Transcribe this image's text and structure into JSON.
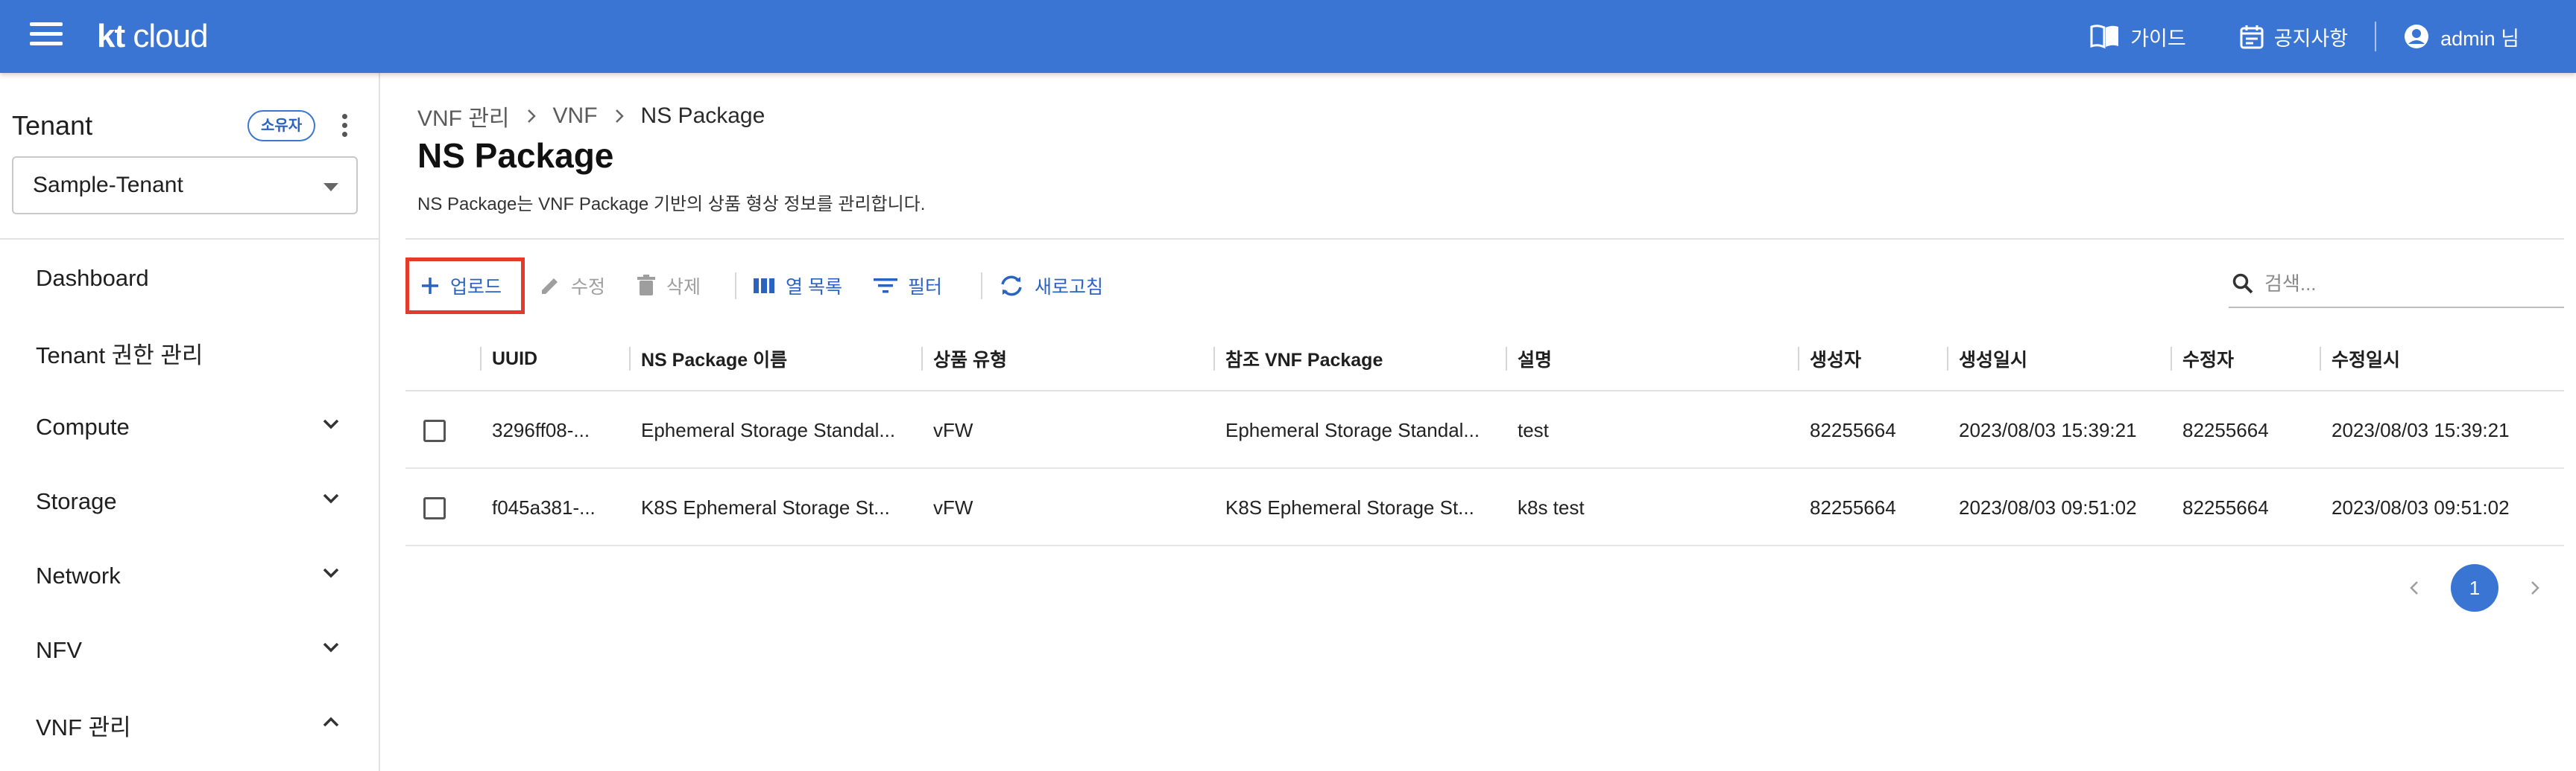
{
  "appbar": {
    "brand_kt": "kt",
    "brand_cloud": "cloud",
    "guide_label": "가이드",
    "notice_label": "공지사항",
    "user_label": "admin 님",
    "bg_color": "#3a75d4"
  },
  "sidebar": {
    "tenant_title": "Tenant",
    "owner_chip": "소유자",
    "tenant_selected": "Sample-Tenant",
    "items": [
      {
        "label": "Dashboard",
        "chevron": "none"
      },
      {
        "label": "Tenant 권한 관리",
        "chevron": "none"
      },
      {
        "label": "Compute",
        "chevron": "down"
      },
      {
        "label": "Storage",
        "chevron": "down"
      },
      {
        "label": "Network",
        "chevron": "down"
      },
      {
        "label": "NFV",
        "chevron": "down"
      },
      {
        "label": "VNF 관리",
        "chevron": "up"
      }
    ]
  },
  "breadcrumb": [
    "VNF 관리",
    "VNF",
    "NS Package"
  ],
  "page": {
    "title": "NS Package",
    "description": "NS Package는 VNF Package 기반의 상품 형상 정보를 관리합니다."
  },
  "toolbar": {
    "upload": "업로드",
    "edit": "수정",
    "delete": "삭제",
    "columns": "열 목록",
    "filter": "필터",
    "refresh": "새로고침",
    "search_placeholder": "검색...",
    "highlight_color": "#e43a2a"
  },
  "table": {
    "columns": [
      "UUID",
      "NS Package 이름",
      "상품 유형",
      "참조 VNF Package",
      "설명",
      "생성자",
      "생성일시",
      "수정자",
      "수정일시"
    ],
    "rows": [
      [
        "3296ff08-...",
        "Ephemeral Storage Standal...",
        "vFW",
        "Ephemeral Storage Standal...",
        "test",
        "82255664",
        "2023/08/03 15:39:21",
        "82255664",
        "2023/08/03 15:39:21"
      ],
      [
        "f045a381-...",
        "K8S Ephemeral Storage St...",
        "vFW",
        "K8S Ephemeral Storage St...",
        "k8s test",
        "82255664",
        "2023/08/03 09:51:02",
        "82255664",
        "2023/08/03 09:51:02"
      ]
    ]
  },
  "pagination": {
    "current": "1"
  }
}
